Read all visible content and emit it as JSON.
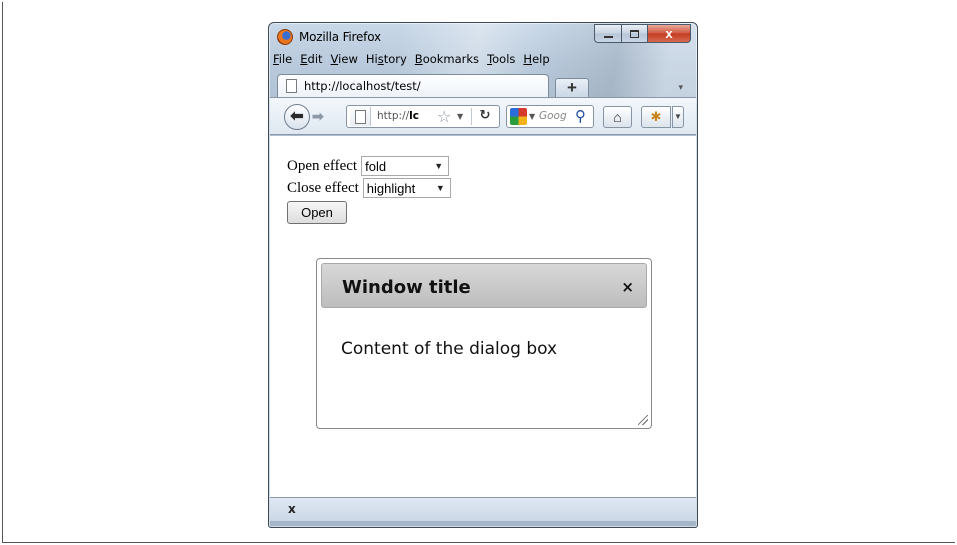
{
  "window": {
    "title": "Mozilla Firefox",
    "controls": {
      "minimize": "",
      "maximize": "",
      "close": "x"
    }
  },
  "menu": {
    "items": [
      {
        "label": "File"
      },
      {
        "label": "Edit"
      },
      {
        "label": "View"
      },
      {
        "label": "History"
      },
      {
        "label": "Bookmarks"
      },
      {
        "label": "Tools"
      },
      {
        "label": "Help"
      }
    ]
  },
  "tabs": {
    "active_label": "http://localhost/test/",
    "new_tab_label": "+"
  },
  "navbar": {
    "url_prefix": "http://",
    "url_host": "lc",
    "search_placeholder": "Goog",
    "icons": [
      "back-icon",
      "forward-icon",
      "page-icon",
      "star-icon",
      "reload-icon",
      "google-icon",
      "search-icon",
      "home-icon",
      "addon-icon"
    ]
  },
  "form": {
    "open_effect_label": "Open effect",
    "open_effect_value": "fold",
    "close_effect_label": "Close effect",
    "close_effect_value": "highlight",
    "open_button_label": "Open"
  },
  "dialog": {
    "title": "Window title",
    "close_label": "×",
    "content": "Content of the dialog box"
  },
  "statusbar": {
    "close_label": "x"
  }
}
